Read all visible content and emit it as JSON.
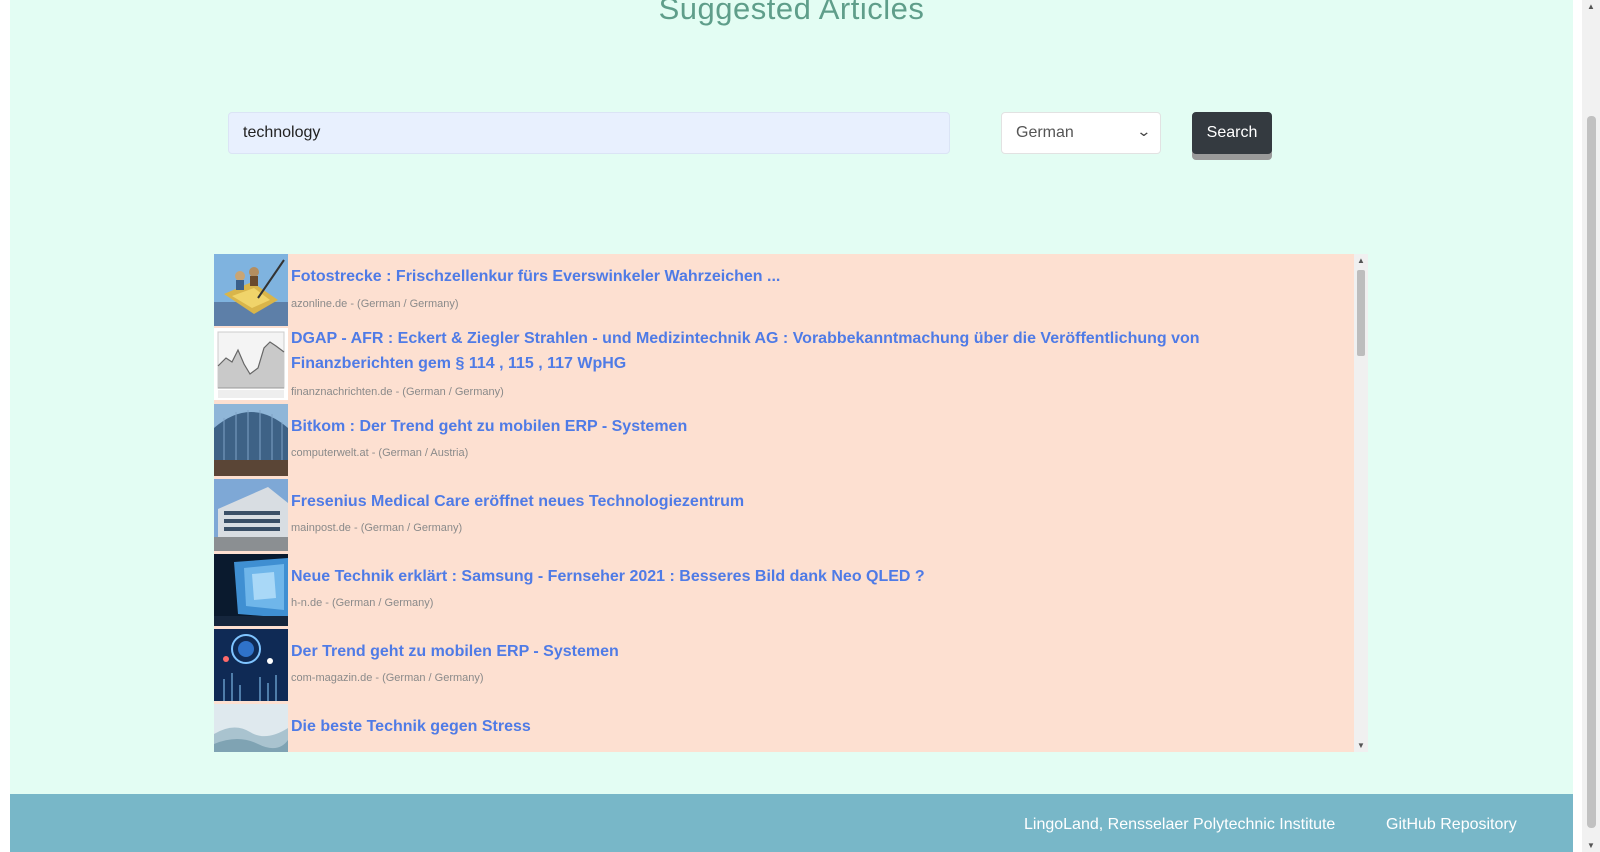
{
  "page": {
    "title": "Suggested Articles"
  },
  "search": {
    "value": "technology",
    "language_selected": "German",
    "button_label": "Search"
  },
  "results": [
    {
      "title": "Fotostrecke : Frischzellenkur fürs Everswinkeler Wahrzeichen ...",
      "source": "azonline.de - (German / Germany)",
      "thumb": "sculpture-image"
    },
    {
      "title": "DGAP - AFR : Eckert & Ziegler Strahlen - und Medizintechnik AG : Vorabbekanntmachung über die Veröffentlichung von Finanzberichten gem § 114 , 115 , 117 WpHG",
      "source": "finanznachrichten.de - (German / Germany)",
      "thumb": "stock-chart-image"
    },
    {
      "title": "Bitkom : Der Trend geht zu mobilen ERP - Systemen",
      "source": "computerwelt.at - (German / Austria)",
      "thumb": "glass-building-image"
    },
    {
      "title": "Fresenius Medical Care eröffnet neues Technologiezentrum",
      "source": "mainpost.de - (German / Germany)",
      "thumb": "office-building-image"
    },
    {
      "title": "Neue Technik erklärt : Samsung - Fernseher 2021 : Besseres Bild dank Neo QLED ?",
      "source": "h-n.de - (German / Germany)",
      "thumb": "blue-ice-image"
    },
    {
      "title": "Der Trend geht zu mobilen ERP - Systemen",
      "source": "com-magazin.de - (German / Germany)",
      "thumb": "digital-network-image"
    },
    {
      "title": "Die beste Technik gegen Stress",
      "source": "",
      "thumb": "landscape-image"
    }
  ],
  "footer": {
    "institution_link": "LingoLand, Rensselaer Polytechnic Institute",
    "repo_link": "GitHub Repository"
  },
  "colors": {
    "page_background": "#e3fdf3",
    "results_background": "#fde0d1",
    "link_color": "#4f7be6",
    "footer_background": "#78b7c8",
    "button_background": "#343a40"
  }
}
